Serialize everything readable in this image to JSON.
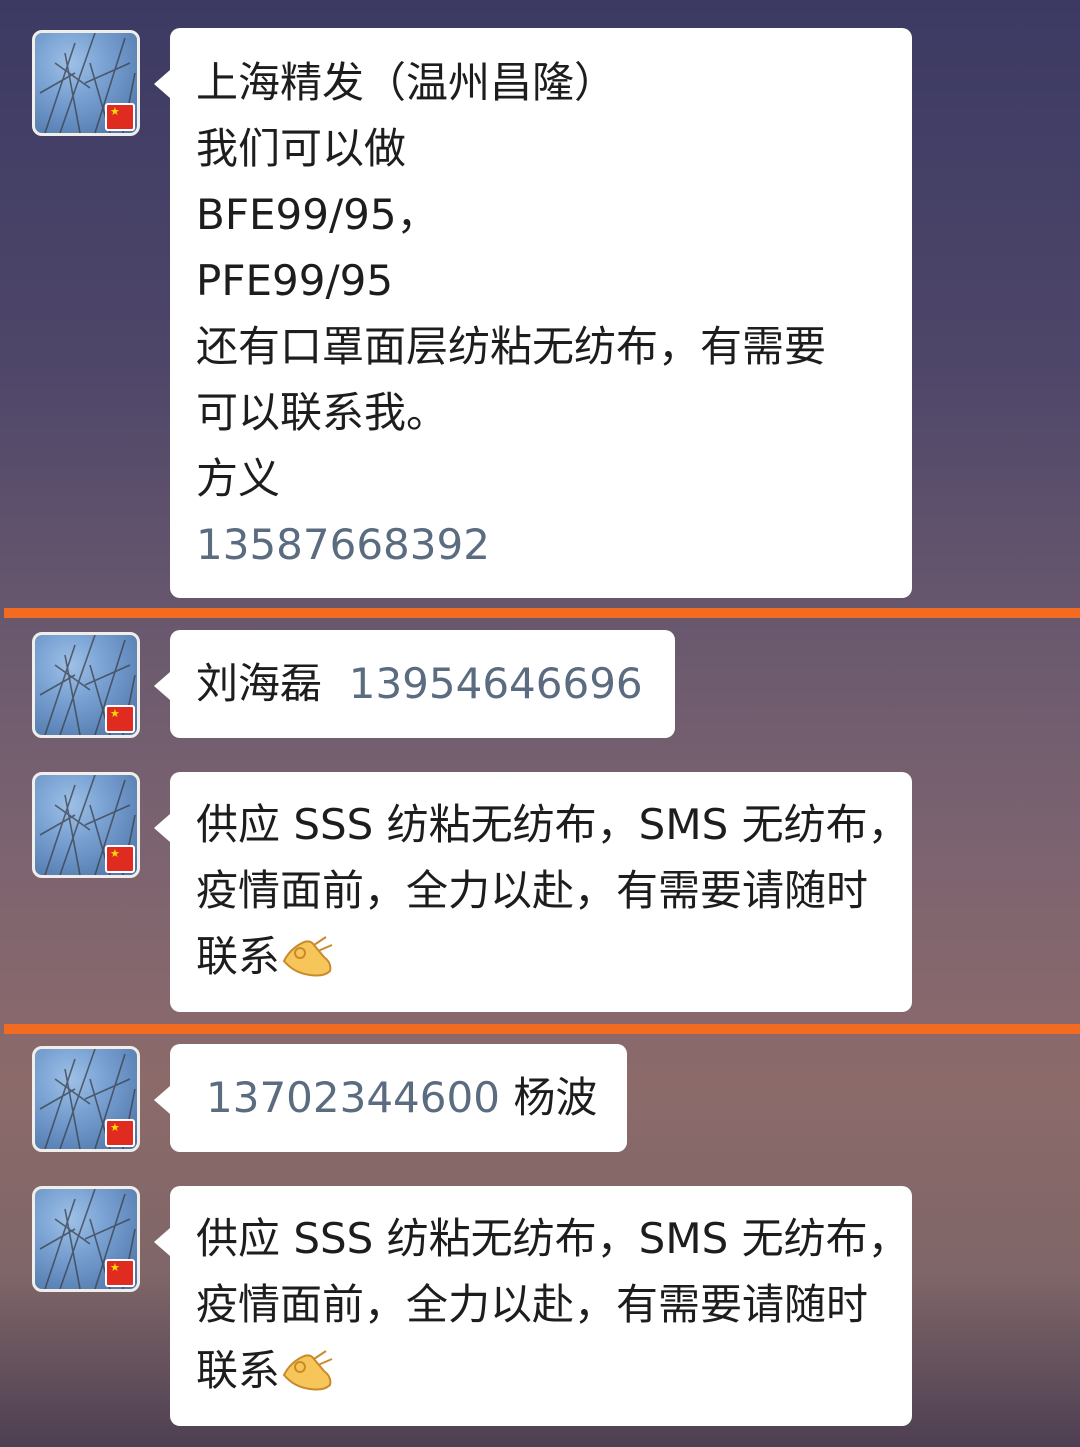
{
  "messages": [
    {
      "lines": [
        "上海精发（温州昌隆）",
        "我们可以做",
        "BFE99/95，",
        "PFE99/95",
        "还有口罩面层纺粘无纺布，有需要",
        "可以联系我。",
        "方义"
      ],
      "phone": "13587668392"
    },
    {
      "name": "刘海磊",
      "phone": "13954646696"
    },
    {
      "lines": [
        "供应 SSS 纺粘无纺布，SMS 无纺布，",
        "疫情面前，全力以赴，有需要请随时",
        "联系"
      ],
      "emoji": "ok-hand-icon"
    },
    {
      "phone": "13702344600",
      "name": "杨波"
    },
    {
      "lines": [
        "供应 SSS 纺粘无纺布，SMS 无纺布，",
        "疫情面前，全力以赴，有需要请随时",
        "联系"
      ],
      "emoji": "ok-hand-icon"
    }
  ],
  "colors": {
    "separator": "#f26b21",
    "bubble": "#ffffff",
    "phone_link": "#5b6b80",
    "flag": "#e02b20"
  }
}
